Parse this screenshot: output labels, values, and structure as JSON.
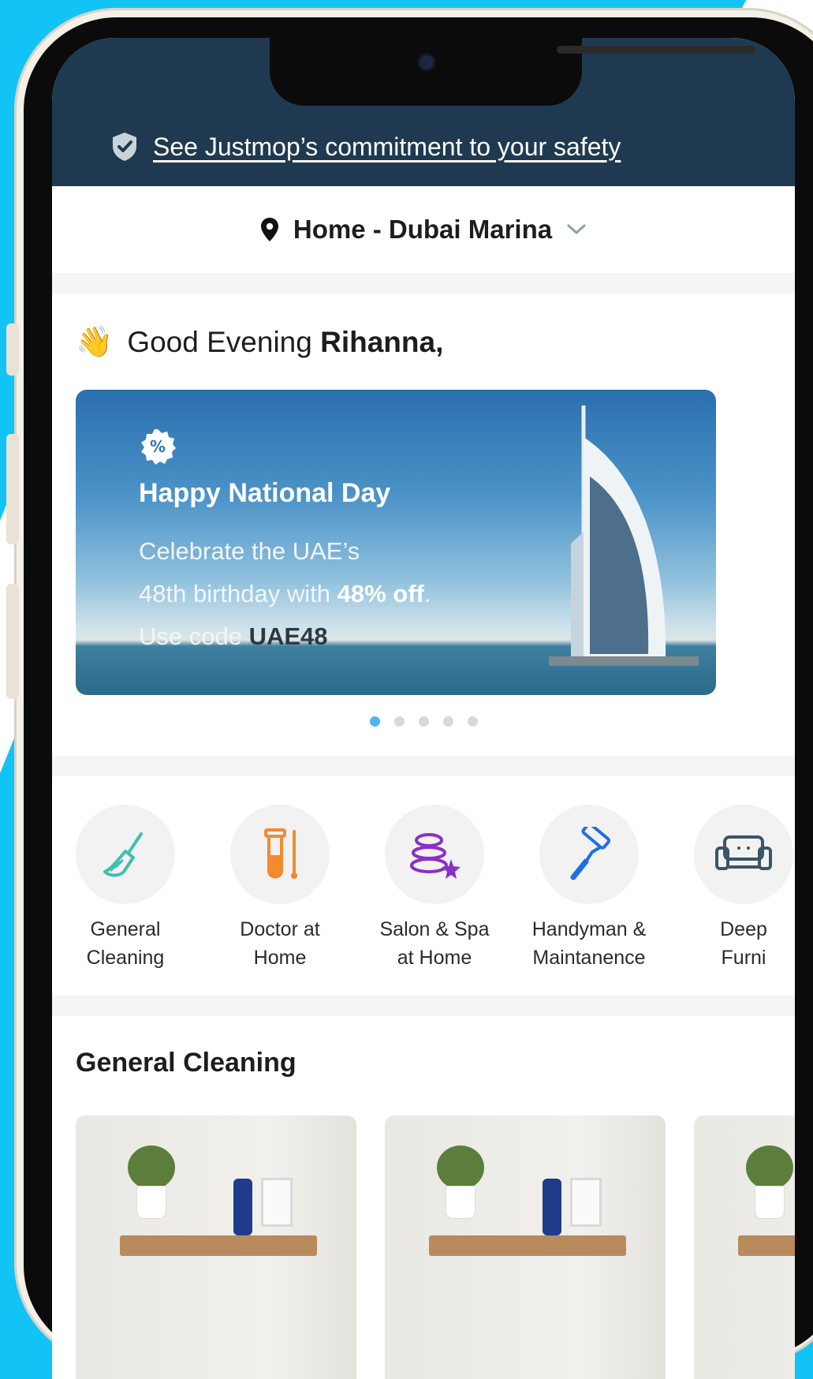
{
  "safety_banner": {
    "link_text": "See Justmop’s commitment to your safety"
  },
  "location": {
    "label": "Home - Dubai Marina"
  },
  "greeting": {
    "prefix": "Good Evening",
    "name": "Rihanna,"
  },
  "promo": {
    "title": "Happy National Day",
    "line1": "Celebrate the UAE’s",
    "line2_prefix": "48th birthday with",
    "discount": "48% off",
    "line2_suffix": ".",
    "code_prefix": "Use code",
    "code": "UAE48",
    "slides_total": 5,
    "active_slide": 1
  },
  "categories": [
    {
      "label": "General\nCleaning",
      "icon": "broom-icon",
      "color": "#3fbfad"
    },
    {
      "label": "Doctor at\nHome",
      "icon": "test-tube-icon",
      "color": "#f28a2e"
    },
    {
      "label": "Salon & Spa\nat Home",
      "icon": "spa-stones-icon",
      "color": "#8b2fc9"
    },
    {
      "label": "Handyman &\nMaintanence",
      "icon": "paint-roller-icon",
      "color": "#1e6fe0"
    },
    {
      "label": "Deep\nFurni",
      "icon": "sofa-icon",
      "color": "#3b5566"
    }
  ],
  "section": {
    "title": "General Cleaning"
  },
  "colors": {
    "header_bg": "#1f3a50",
    "accent": "#4fb6ec",
    "page_bg": "#12c3f5"
  }
}
